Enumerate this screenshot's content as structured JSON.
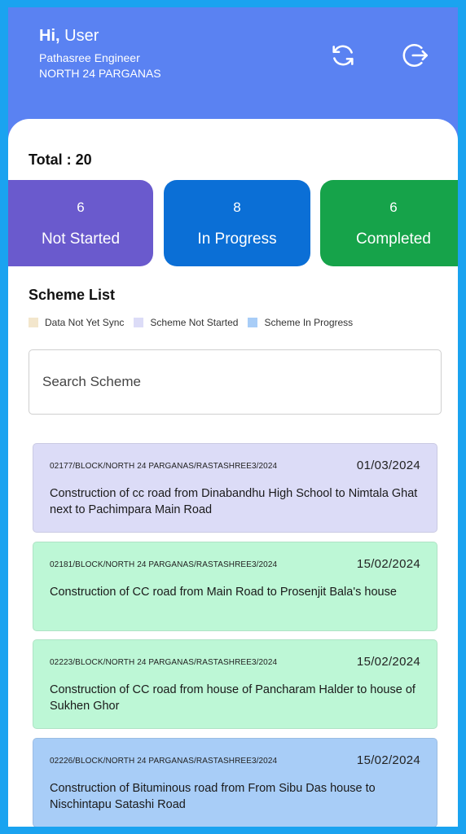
{
  "header": {
    "greeting_prefix": "Hi,",
    "greeting_name": "User",
    "role": "Pathasree Engineer",
    "district": "NORTH 24 PARGANAS",
    "sync_icon": "sync-icon",
    "logout_icon": "logout-icon"
  },
  "summary": {
    "total_label": "Total : 20",
    "stats": [
      {
        "count": "6",
        "label": "Not Started",
        "color": "#6a5acd"
      },
      {
        "count": "8",
        "label": "In Progress",
        "color": "#0b6fd6"
      },
      {
        "count": "6",
        "label": "Completed",
        "color": "#16a34a"
      }
    ]
  },
  "scheme_list": {
    "title": "Scheme List",
    "legend": [
      {
        "label": "Data Not Yet Sync",
        "color": "#f3e6cc"
      },
      {
        "label": "Scheme Not Started",
        "color": "#dcdcf7"
      },
      {
        "label": "Scheme In Progress",
        "color": "#a8cdf7"
      }
    ],
    "search_placeholder": "Search Scheme",
    "items": [
      {
        "code": "02177/BLOCK/NORTH 24 PARGANAS/RASTASHREE3/2024",
        "date": "01/03/2024",
        "description": "Construction of  cc road from  Dinabandhu High School to Nimtala Ghat next to Pachimpara Main Road",
        "color": "#dcdcf7"
      },
      {
        "code": "02181/BLOCK/NORTH 24 PARGANAS/RASTASHREE3/2024",
        "date": "15/02/2024",
        "description": "Construction of  CC road from Main Road to Prosenjit Bala's house",
        "color": "#bdf7d6"
      },
      {
        "code": "02223/BLOCK/NORTH 24 PARGANAS/RASTASHREE3/2024",
        "date": "15/02/2024",
        "description": "Construction of  CC road from house of Pancharam Halder to house of Sukhen Ghor",
        "color": "#bdf7d6"
      },
      {
        "code": "02226/BLOCK/NORTH 24 PARGANAS/RASTASHREE3/2024",
        "date": "15/02/2024",
        "description": "Construction of  Bituminous road from From Sibu Das house to Nischintapu Satashi Road",
        "color": "#a8cdf7"
      }
    ]
  }
}
